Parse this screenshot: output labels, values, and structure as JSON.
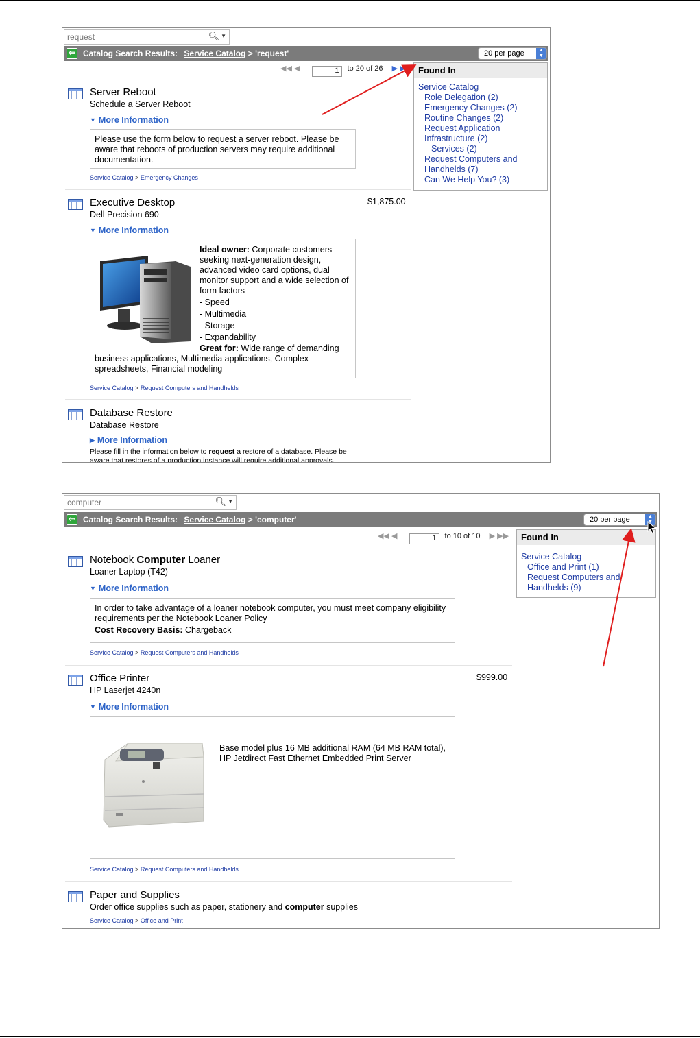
{
  "panel1": {
    "search": {
      "value": "request"
    },
    "title_prefix": "Catalog Search Results:",
    "title_link": "Service Catalog",
    "title_suffix": "> 'request'",
    "per_page": "20 per page",
    "pager": {
      "page": "1",
      "range": "to 20 of 26"
    },
    "found_in": {
      "heading": "Found In",
      "items": [
        {
          "label": "Service Catalog",
          "level": 0
        },
        {
          "label": "Role Delegation (2)",
          "level": 1
        },
        {
          "label": "Emergency Changes (2)",
          "level": 1
        },
        {
          "label": "Routine Changes (2)",
          "level": 1
        },
        {
          "label": "Request Application",
          "level": 1
        },
        {
          "label": "Infrastructure (2)",
          "level": 1
        },
        {
          "label": "Services (2)",
          "level": 2
        },
        {
          "label": "Request Computers and",
          "level": 1
        },
        {
          "label": "Handhelds (7)",
          "level": 1
        },
        {
          "label": "Can We Help You? (3)",
          "level": 1
        }
      ]
    },
    "results": [
      {
        "title": "Server Reboot",
        "subtitle": "Schedule a Server Reboot",
        "more": "More Information",
        "description": "Please use the form below to request a server reboot. Please be aware that reboots of production servers may require additional documentation.",
        "crumb_root": "Service Catalog",
        "crumb_leaf": "Emergency Changes"
      },
      {
        "title": "Executive Desktop",
        "subtitle": "Dell Precision 690",
        "price": "$1,875.00",
        "more": "More Information",
        "ideal_label": "Ideal owner:",
        "ideal_text": "Corporate customers seeking next-generation design, advanced video card options, dual monitor support and a wide selection of form factors",
        "features": [
          "- Speed",
          "- Multimedia",
          "- Storage",
          "- Expandability"
        ],
        "great_label": "Great for:",
        "great_text": "Wide range of demanding business applications, Multimedia applications, Complex spreadsheets, Financial modeling",
        "crumb_root": "Service Catalog",
        "crumb_leaf": "Request Computers and Handhelds"
      },
      {
        "title": "Database Restore",
        "subtitle": "Database Restore",
        "more": "More Information",
        "desc_a": "Please fill in the information below to",
        "desc_bold": "request",
        "desc_b": "a restore of a database. Please be aware that restores of a production instance will require additional approvals."
      }
    ]
  },
  "panel2": {
    "search": {
      "value": "computer"
    },
    "title_prefix": "Catalog Search Results:",
    "title_link": "Service Catalog",
    "title_suffix": "> 'computer'",
    "per_page": "20 per page",
    "pager": {
      "page": "1",
      "range": "to 10 of 10"
    },
    "found_in": {
      "heading": "Found In",
      "items": [
        {
          "label": "Service Catalog",
          "level": 0
        },
        {
          "label": "Office and Print (1)",
          "level": 1
        },
        {
          "label": "Request Computers and",
          "level": 1
        },
        {
          "label": "Handhelds (9)",
          "level": 1
        }
      ]
    },
    "results": [
      {
        "title_a": "Notebook",
        "title_bold": "Computer",
        "title_b": "Loaner",
        "subtitle": "Loaner Laptop (T42)",
        "more": "More Information",
        "description": "In order to take advantage of a loaner notebook computer, you must meet company eligibility requirements per the Notebook Loaner Policy",
        "cost_label": "Cost Recovery Basis:",
        "cost_value": "Chargeback",
        "crumb_root": "Service Catalog",
        "crumb_leaf": "Request Computers and Handhelds"
      },
      {
        "title": "Office Printer",
        "subtitle": "HP Laserjet 4240n",
        "price": "$999.00",
        "more": "More Information",
        "description": "Base model plus 16 MB additional RAM (64 MB RAM total), HP Jetdirect Fast Ethernet Embedded Print Server",
        "crumb_root": "Service Catalog",
        "crumb_leaf": "Request Computers and Handhelds"
      },
      {
        "title": "Paper and Supplies",
        "sub_a": "Order office supplies such as paper, stationery and",
        "sub_bold": "computer",
        "sub_b": "supplies",
        "crumb_root": "Service Catalog",
        "crumb_leaf": "Office and Print"
      }
    ]
  },
  "colors": {
    "accent_link": "#1d3aa3",
    "more_info": "#2e64c8",
    "titlebar": "#7b7b7b",
    "annotation_arrow": "#e01e1e"
  },
  "icons": {
    "back": "back-arrow-icon",
    "search": "magnifier-icon",
    "catalog": "catalog-item-icon"
  }
}
